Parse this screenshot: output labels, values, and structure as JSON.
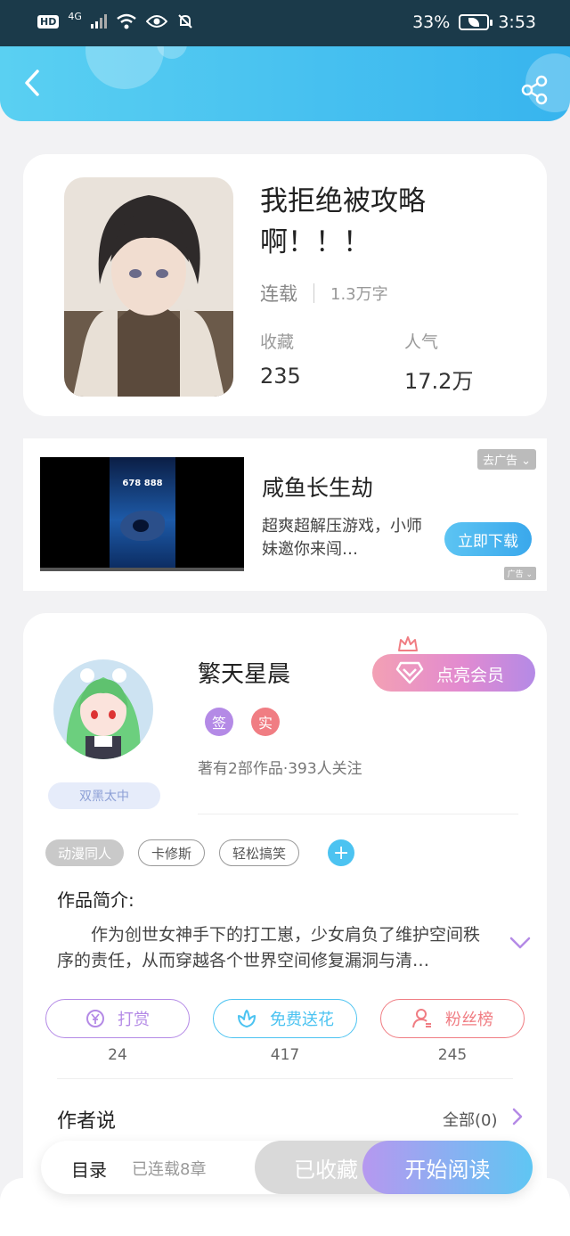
{
  "status_bar": {
    "hd": "HD",
    "network": "4G",
    "battery_pct": "33%",
    "time": "3:53"
  },
  "book": {
    "title": "我拒绝被攻略啊！！！",
    "status": "连载",
    "word_count": "1.3万字",
    "favorites_label": "收藏",
    "favorites_value": "235",
    "popularity_label": "人气",
    "popularity_value": "17.2万"
  },
  "ad": {
    "close_label": "去广告",
    "title": "咸鱼长生劫",
    "description": "超爽超解压游戏，小师妹邀你来闯…",
    "cta": "立即下载",
    "badge": "广告",
    "video_score": "678 888"
  },
  "author": {
    "name": "繁天星晨",
    "tag": "双黑太中",
    "vip_button": "点亮会员",
    "badge_sign": "签",
    "badge_real": "实",
    "meta": "著有2部作品·393人关注",
    "colors": {
      "sign": "#b48ae6",
      "real": "#f07d83",
      "vip_start": "#f3a0b4",
      "vip_end": "#b48ae6"
    }
  },
  "tags": [
    {
      "label": "动漫同人",
      "style": "filled"
    },
    {
      "label": "卡修斯",
      "style": "outline"
    },
    {
      "label": "轻松搞笑",
      "style": "outline"
    }
  ],
  "intro": {
    "label": "作品简介:",
    "text": "作为创世女神手下的打工崽，少女肩负了维护空间秩序的责任，从而穿越各个世界空间修复漏洞与清…"
  },
  "actions": [
    {
      "label": "打赏",
      "count": "24",
      "icon": "yen-coin-icon",
      "color": "#b48ae6"
    },
    {
      "label": "免费送花",
      "count": "417",
      "icon": "flower-icon",
      "color": "#4cc3f1"
    },
    {
      "label": "粉丝榜",
      "count": "245",
      "icon": "user-rank-icon",
      "color": "#f07d83"
    }
  ],
  "author_says": {
    "label": "作者说",
    "all_label": "全部(0)"
  },
  "bottom_bar": {
    "catalog": "目录",
    "chapters": "已连载8章",
    "favorited": "已收藏",
    "start_reading": "开始阅读"
  }
}
